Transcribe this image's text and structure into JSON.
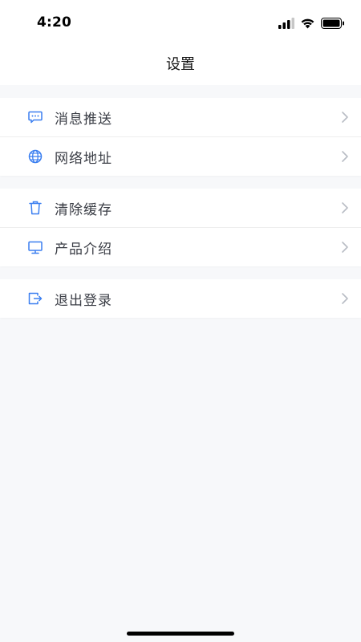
{
  "status_bar": {
    "time": "4:20"
  },
  "nav": {
    "title": "设置"
  },
  "groups": [
    {
      "items": [
        {
          "label": "消息推送",
          "icon": "message-icon"
        },
        {
          "label": "网络地址",
          "icon": "globe-icon"
        }
      ]
    },
    {
      "items": [
        {
          "label": "清除缓存",
          "icon": "trash-icon"
        },
        {
          "label": "产品介绍",
          "icon": "monitor-icon"
        }
      ]
    },
    {
      "items": [
        {
          "label": "退出登录",
          "icon": "logout-icon"
        }
      ]
    }
  ],
  "colors": {
    "accent": "#3b7ff0",
    "background": "#f7f8fa",
    "label": "#3a3d45",
    "chevron": "#b8bcc4"
  }
}
